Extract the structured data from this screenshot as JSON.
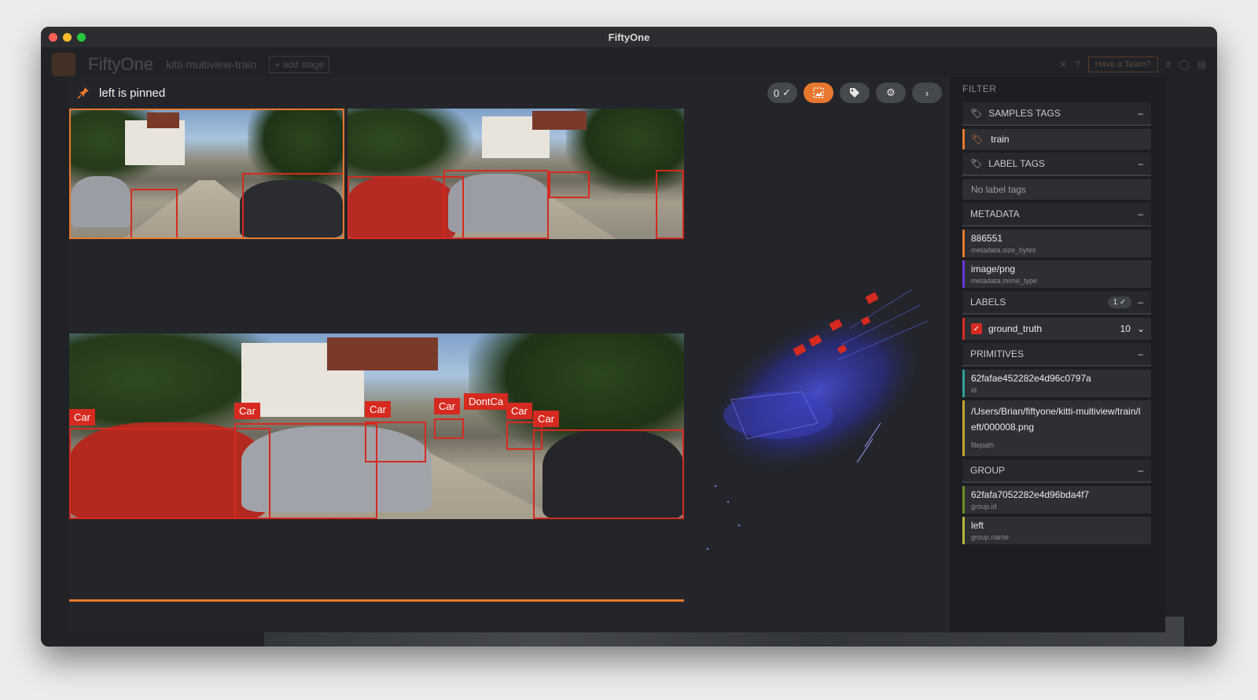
{
  "window": {
    "title": "FiftyOne"
  },
  "background": {
    "brand": "FiftyOne",
    "dataset": "kitti-multiview-train",
    "add_stage": "+ add stage",
    "team_button": "Have a Team?"
  },
  "modal": {
    "pinned_label": "left is pinned",
    "toolbar": {
      "selected_count": "0"
    },
    "labels": [
      "Car",
      "Car",
      "Car",
      "Car",
      "DontCa",
      "Car",
      "Car"
    ]
  },
  "sidebar": {
    "filter_title": "FILTER",
    "samples_tags": {
      "title": "SAMPLES TAGS",
      "items": [
        "train"
      ]
    },
    "label_tags": {
      "title": "LABEL TAGS",
      "empty": "No label tags"
    },
    "metadata": {
      "title": "METADATA",
      "fields": [
        {
          "value": "886551",
          "name": "metadata.size_bytes",
          "color": "#e8782e"
        },
        {
          "value": "image/png",
          "name": "metadata.mime_type",
          "color": "#6a36d8"
        }
      ]
    },
    "labels": {
      "title": "LABELS",
      "badge": "1 ✓",
      "field": "ground_truth",
      "count": "10"
    },
    "primitives": {
      "title": "PRIMITIVES",
      "fields": [
        {
          "value": "62fafae452282e4d96c0797a",
          "name": "id",
          "color": "#2aa198"
        },
        {
          "value": "/Users/Brian/fiftyone/kitti-multiview/train/left/000008.png",
          "name": "filepath",
          "color": "#c7a32e"
        }
      ]
    },
    "group": {
      "title": "GROUP",
      "fields": [
        {
          "value": "62fafa7052282e4d96bda4f7",
          "name": "group.id",
          "color": "#6b8e23"
        },
        {
          "value": "left",
          "name": "group.name",
          "color": "#b7b43a"
        }
      ]
    }
  },
  "colors": {
    "accent": "#e8782e",
    "label_red": "#d62a20",
    "panel": "#23252a"
  }
}
